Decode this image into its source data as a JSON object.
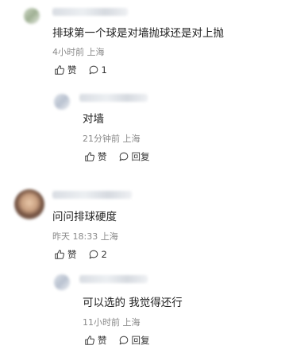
{
  "comments": [
    {
      "text": "排球第一个球是对墙抛球还是对上抛",
      "meta": "4小时前 上海",
      "like_label": "赞",
      "reply_count": "1"
    },
    {
      "text": "对墙",
      "meta": "21分钟前 上海",
      "like_label": "赞",
      "reply_label": "回复"
    },
    {
      "text": "问问排球硬度",
      "meta": "昨天 18:33 上海",
      "like_label": "赞",
      "reply_count": "2"
    },
    {
      "text": "可以选的 我觉得还行",
      "meta": "11小时前 上海",
      "like_label": "赞",
      "reply_label": "回复"
    }
  ],
  "colors": {
    "meta": "#8a8a8a",
    "text": "#1f1f1f",
    "icon": "#444444"
  }
}
